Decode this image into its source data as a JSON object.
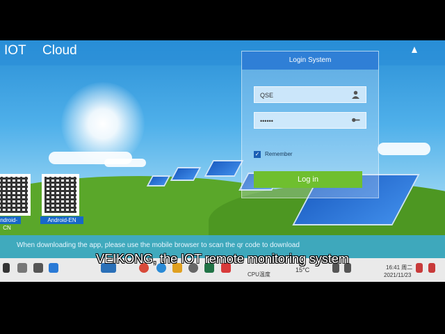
{
  "header": {
    "brand_left": "IOT",
    "brand_right": "Cloud"
  },
  "login": {
    "title": "Login System",
    "username_value": "QSE",
    "password_value": "••••••",
    "remember_label": "Remember",
    "remember_checked": true,
    "button_label": "Log in"
  },
  "qr_codes": [
    {
      "label": "Android-CN"
    },
    {
      "label": "Android-EN"
    }
  ],
  "info_bar": {
    "text": "When downloading the app, please use the mobile browser to scan the qr code to download"
  },
  "taskbar": {
    "cpu_label": "CPU温度",
    "temperature": "15°C",
    "time": "16:41 周二",
    "date": "2021/11/23"
  },
  "caption": "VEIKONG, the IOT remote monitoring system",
  "colors": {
    "header": "#2f7fd6",
    "login_button": "#6fbf2f",
    "qr_label": "#1768c8"
  }
}
